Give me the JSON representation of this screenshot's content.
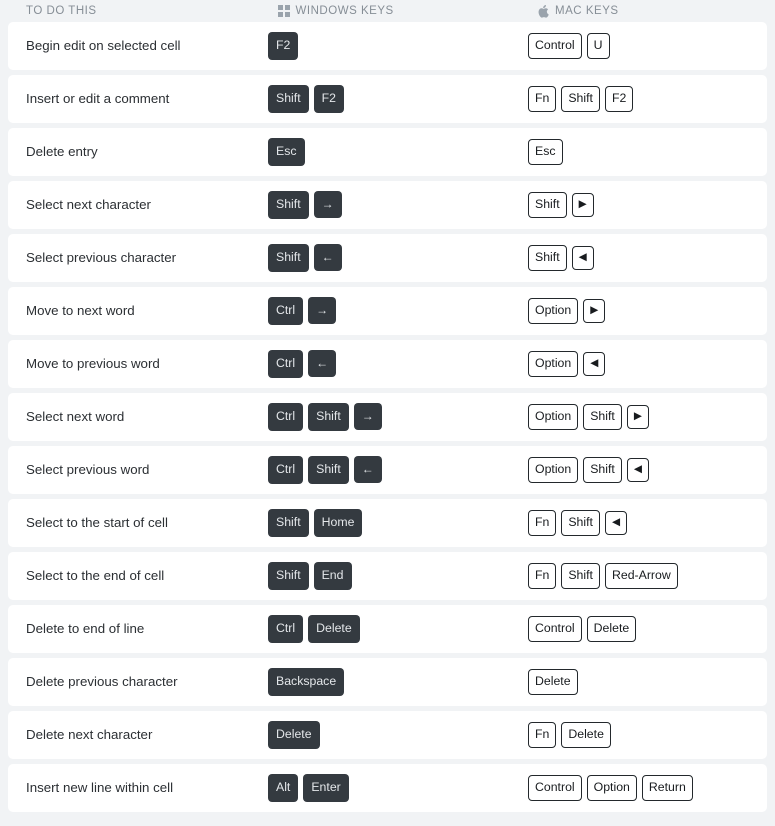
{
  "header": {
    "columns": [
      {
        "label": "TO DO THIS",
        "icon": null
      },
      {
        "label": "WINDOWS KEYS",
        "icon": "windows-logo-icon"
      },
      {
        "label": "MAC KEYS",
        "icon": "apple-logo-icon"
      }
    ]
  },
  "colors": {
    "page_background": "#f1f3f5",
    "row_background": "#ffffff",
    "header_text": "#868e96",
    "body_text": "#2b2f33",
    "windows_key_background": "#343a40",
    "windows_key_text": "#e4e7ea",
    "mac_key_border": "#23282c",
    "mac_key_text": "#181b1e"
  },
  "rows": [
    {
      "action": "Begin edit on selected cell",
      "windows": [
        "F2"
      ],
      "mac": [
        "Control",
        "U"
      ]
    },
    {
      "action": "Insert or edit a comment",
      "windows": [
        "Shift",
        "F2"
      ],
      "mac": [
        "Fn",
        "Shift",
        "F2"
      ]
    },
    {
      "action": "Delete entry",
      "windows": [
        "Esc"
      ],
      "mac": [
        "Esc"
      ]
    },
    {
      "action": "Select next character",
      "windows": [
        "Shift",
        "→"
      ],
      "mac": [
        "Shift",
        "▶"
      ]
    },
    {
      "action": "Select previous character",
      "windows": [
        "Shift",
        "←"
      ],
      "mac": [
        "Shift",
        "◀"
      ]
    },
    {
      "action": "Move to next word",
      "windows": [
        "Ctrl",
        "→"
      ],
      "mac": [
        "Option",
        "▶"
      ]
    },
    {
      "action": "Move to previous word",
      "windows": [
        "Ctrl",
        "←"
      ],
      "mac": [
        "Option",
        "◀"
      ]
    },
    {
      "action": "Select next word",
      "windows": [
        "Ctrl",
        "Shift",
        "→"
      ],
      "mac": [
        "Option",
        "Shift",
        "▶"
      ]
    },
    {
      "action": "Select previous word",
      "windows": [
        "Ctrl",
        "Shift",
        "←"
      ],
      "mac": [
        "Option",
        "Shift",
        "◀"
      ]
    },
    {
      "action": "Select to the start of cell",
      "windows": [
        "Shift",
        "Home"
      ],
      "mac": [
        "Fn",
        "Shift",
        "◀"
      ]
    },
    {
      "action": "Select to the end of cell",
      "windows": [
        "Shift",
        "End"
      ],
      "mac": [
        "Fn",
        "Shift",
        "Red-Arrow"
      ]
    },
    {
      "action": "Delete to end of line",
      "windows": [
        "Ctrl",
        "Delete"
      ],
      "mac": [
        "Control",
        "Delete"
      ]
    },
    {
      "action": "Delete previous character",
      "windows": [
        "Backspace"
      ],
      "mac": [
        "Delete"
      ]
    },
    {
      "action": "Delete next character",
      "windows": [
        "Delete"
      ],
      "mac": [
        "Fn",
        "Delete"
      ]
    },
    {
      "action": "Insert new line within cell",
      "windows": [
        "Alt",
        "Enter"
      ],
      "mac": [
        "Control",
        "Option",
        "Return"
      ]
    }
  ]
}
